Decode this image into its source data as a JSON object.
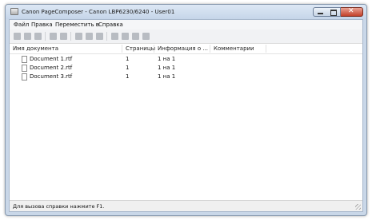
{
  "window": {
    "title": "Canon PageComposer - Canon LBP6230/6240 - User01"
  },
  "menu": [
    "Файл",
    "Правка",
    "Переместить в",
    "Справка"
  ],
  "toolbar": [
    "print-icon",
    "copy-icon",
    "delete-icon",
    "merge-icon",
    "split-icon",
    "move-up-icon",
    "move-down-icon",
    "properties-icon",
    "first-icon",
    "prev-icon",
    "next-icon",
    "last-icon"
  ],
  "columns": [
    "Имя документа",
    "Страницы",
    "Информация о ...",
    "Комментарии"
  ],
  "rows": [
    {
      "name": "Document 1.rtf",
      "pages": "1",
      "info": "1 на 1",
      "comment": ""
    },
    {
      "name": "Document 2.rtf",
      "pages": "1",
      "info": "1 на 1",
      "comment": ""
    },
    {
      "name": "Document 3.rtf",
      "pages": "1",
      "info": "1 на 1",
      "comment": ""
    }
  ],
  "status": "Для вызова справки нажмите F1."
}
